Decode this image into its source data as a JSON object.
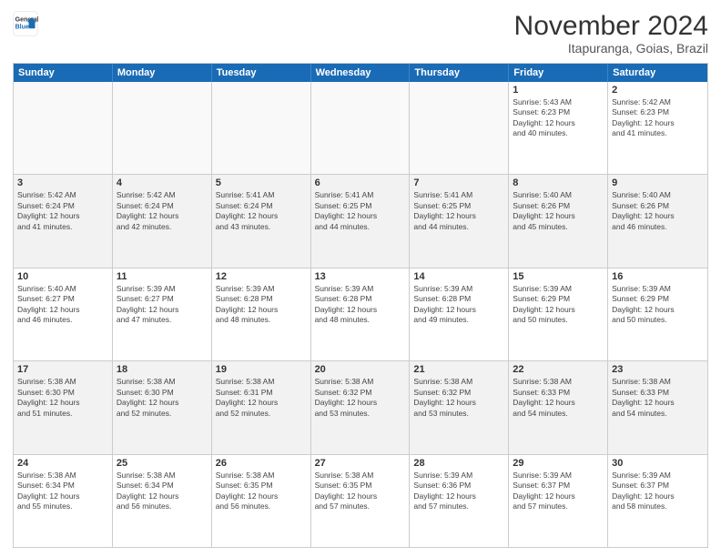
{
  "logo": {
    "line1": "General",
    "line2": "Blue"
  },
  "title": "November 2024",
  "location": "Itapuranga, Goias, Brazil",
  "days_of_week": [
    "Sunday",
    "Monday",
    "Tuesday",
    "Wednesday",
    "Thursday",
    "Friday",
    "Saturday"
  ],
  "weeks": [
    [
      {
        "day": "",
        "info": ""
      },
      {
        "day": "",
        "info": ""
      },
      {
        "day": "",
        "info": ""
      },
      {
        "day": "",
        "info": ""
      },
      {
        "day": "",
        "info": ""
      },
      {
        "day": "1",
        "info": "Sunrise: 5:43 AM\nSunset: 6:23 PM\nDaylight: 12 hours\nand 40 minutes."
      },
      {
        "day": "2",
        "info": "Sunrise: 5:42 AM\nSunset: 6:23 PM\nDaylight: 12 hours\nand 41 minutes."
      }
    ],
    [
      {
        "day": "3",
        "info": "Sunrise: 5:42 AM\nSunset: 6:24 PM\nDaylight: 12 hours\nand 41 minutes."
      },
      {
        "day": "4",
        "info": "Sunrise: 5:42 AM\nSunset: 6:24 PM\nDaylight: 12 hours\nand 42 minutes."
      },
      {
        "day": "5",
        "info": "Sunrise: 5:41 AM\nSunset: 6:24 PM\nDaylight: 12 hours\nand 43 minutes."
      },
      {
        "day": "6",
        "info": "Sunrise: 5:41 AM\nSunset: 6:25 PM\nDaylight: 12 hours\nand 44 minutes."
      },
      {
        "day": "7",
        "info": "Sunrise: 5:41 AM\nSunset: 6:25 PM\nDaylight: 12 hours\nand 44 minutes."
      },
      {
        "day": "8",
        "info": "Sunrise: 5:40 AM\nSunset: 6:26 PM\nDaylight: 12 hours\nand 45 minutes."
      },
      {
        "day": "9",
        "info": "Sunrise: 5:40 AM\nSunset: 6:26 PM\nDaylight: 12 hours\nand 46 minutes."
      }
    ],
    [
      {
        "day": "10",
        "info": "Sunrise: 5:40 AM\nSunset: 6:27 PM\nDaylight: 12 hours\nand 46 minutes."
      },
      {
        "day": "11",
        "info": "Sunrise: 5:39 AM\nSunset: 6:27 PM\nDaylight: 12 hours\nand 47 minutes."
      },
      {
        "day": "12",
        "info": "Sunrise: 5:39 AM\nSunset: 6:28 PM\nDaylight: 12 hours\nand 48 minutes."
      },
      {
        "day": "13",
        "info": "Sunrise: 5:39 AM\nSunset: 6:28 PM\nDaylight: 12 hours\nand 48 minutes."
      },
      {
        "day": "14",
        "info": "Sunrise: 5:39 AM\nSunset: 6:28 PM\nDaylight: 12 hours\nand 49 minutes."
      },
      {
        "day": "15",
        "info": "Sunrise: 5:39 AM\nSunset: 6:29 PM\nDaylight: 12 hours\nand 50 minutes."
      },
      {
        "day": "16",
        "info": "Sunrise: 5:39 AM\nSunset: 6:29 PM\nDaylight: 12 hours\nand 50 minutes."
      }
    ],
    [
      {
        "day": "17",
        "info": "Sunrise: 5:38 AM\nSunset: 6:30 PM\nDaylight: 12 hours\nand 51 minutes."
      },
      {
        "day": "18",
        "info": "Sunrise: 5:38 AM\nSunset: 6:30 PM\nDaylight: 12 hours\nand 52 minutes."
      },
      {
        "day": "19",
        "info": "Sunrise: 5:38 AM\nSunset: 6:31 PM\nDaylight: 12 hours\nand 52 minutes."
      },
      {
        "day": "20",
        "info": "Sunrise: 5:38 AM\nSunset: 6:32 PM\nDaylight: 12 hours\nand 53 minutes."
      },
      {
        "day": "21",
        "info": "Sunrise: 5:38 AM\nSunset: 6:32 PM\nDaylight: 12 hours\nand 53 minutes."
      },
      {
        "day": "22",
        "info": "Sunrise: 5:38 AM\nSunset: 6:33 PM\nDaylight: 12 hours\nand 54 minutes."
      },
      {
        "day": "23",
        "info": "Sunrise: 5:38 AM\nSunset: 6:33 PM\nDaylight: 12 hours\nand 54 minutes."
      }
    ],
    [
      {
        "day": "24",
        "info": "Sunrise: 5:38 AM\nSunset: 6:34 PM\nDaylight: 12 hours\nand 55 minutes."
      },
      {
        "day": "25",
        "info": "Sunrise: 5:38 AM\nSunset: 6:34 PM\nDaylight: 12 hours\nand 56 minutes."
      },
      {
        "day": "26",
        "info": "Sunrise: 5:38 AM\nSunset: 6:35 PM\nDaylight: 12 hours\nand 56 minutes."
      },
      {
        "day": "27",
        "info": "Sunrise: 5:38 AM\nSunset: 6:35 PM\nDaylight: 12 hours\nand 57 minutes."
      },
      {
        "day": "28",
        "info": "Sunrise: 5:39 AM\nSunset: 6:36 PM\nDaylight: 12 hours\nand 57 minutes."
      },
      {
        "day": "29",
        "info": "Sunrise: 5:39 AM\nSunset: 6:37 PM\nDaylight: 12 hours\nand 57 minutes."
      },
      {
        "day": "30",
        "info": "Sunrise: 5:39 AM\nSunset: 6:37 PM\nDaylight: 12 hours\nand 58 minutes."
      }
    ]
  ]
}
